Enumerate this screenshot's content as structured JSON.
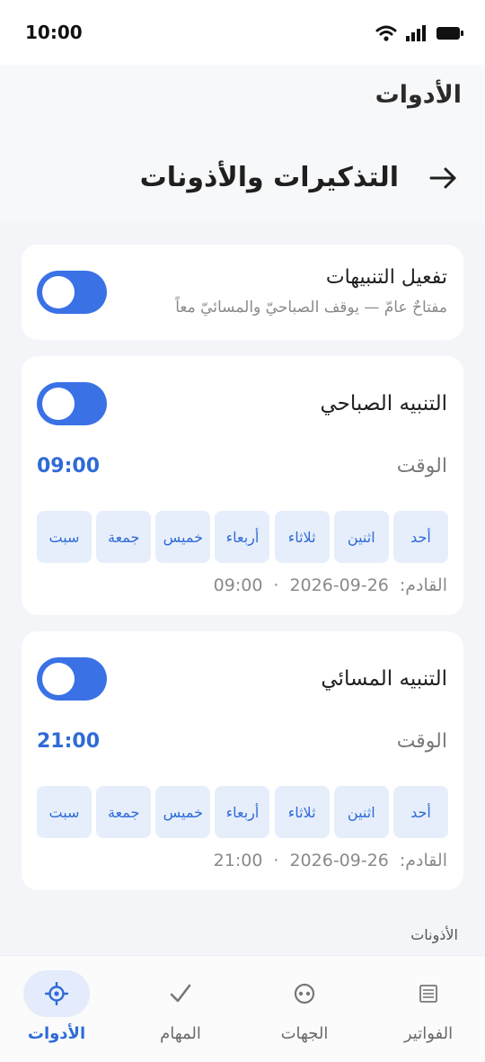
{
  "status_bar": {
    "time": "10:00",
    "icons": [
      "wifi-icon",
      "signal-icon",
      "battery-icon"
    ]
  },
  "header": {
    "app_title": "الأدوات",
    "section_title": "التذكيرات والأذونات",
    "back_icon": "arrow-right-icon"
  },
  "master": {
    "title": "تفعيل التنبيهات",
    "subtitle": "مفتاحٌ عامّ — يوقف الصباحيّ والمسائيّ معاً",
    "enabled": true
  },
  "morning": {
    "title": "التنبيه الصباحي",
    "enabled": true,
    "time_label": "الوقت",
    "time": "09:00",
    "days": [
      "أحد",
      "اثنين",
      "ثلاثاء",
      "أربعاء",
      "خميس",
      "جمعة",
      "سبت"
    ],
    "next_label": "القادم:",
    "next_date": "2026-09-26",
    "next_sep": "·",
    "next_time": "09:00"
  },
  "evening": {
    "title": "التنبيه المسائي",
    "enabled": true,
    "time_label": "الوقت",
    "time": "21:00",
    "days": [
      "أحد",
      "اثنين",
      "ثلاثاء",
      "أربعاء",
      "خميس",
      "جمعة",
      "سبت"
    ],
    "next_label": "القادم:",
    "next_date": "2026-09-26",
    "next_sep": "·",
    "next_time": "21:00"
  },
  "adhan_section": {
    "title": "الأذونات"
  },
  "nav": {
    "items": [
      {
        "label": "الأدوات",
        "icon": "tools-icon",
        "active": true
      },
      {
        "label": "المهام",
        "icon": "check-icon",
        "active": false
      },
      {
        "label": "الجهات",
        "icon": "contacts-icon",
        "active": false
      },
      {
        "label": "الفواتير",
        "icon": "invoices-icon",
        "active": false
      }
    ]
  },
  "colors": {
    "accent": "#3a72e6",
    "accent_text": "#2f6bd6",
    "day_chip_bg": "#e6eefc",
    "page_bg": "#f3f5f8"
  }
}
